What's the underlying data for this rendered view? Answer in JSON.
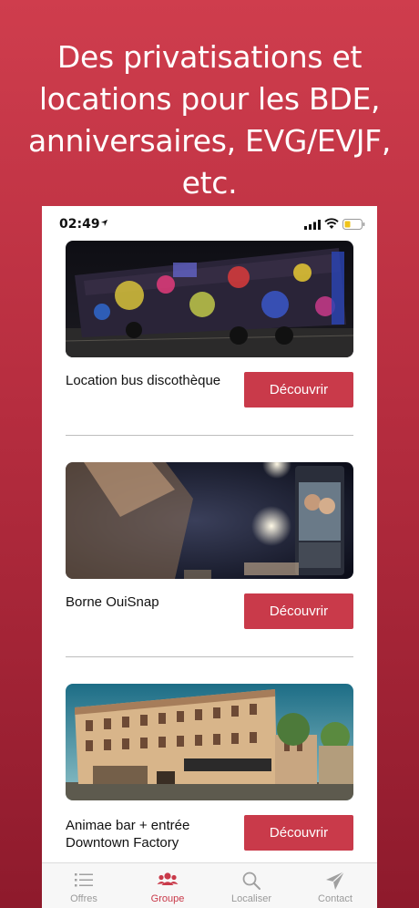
{
  "headline": "Des privatisations et locations pour les BDE, anniversaires, EVG/EVJF, etc.",
  "status": {
    "time": "02:49"
  },
  "colors": {
    "accent": "#c93a4a",
    "background": "#b62d3f"
  },
  "cards": [
    {
      "title": "Location bus discothèque",
      "button": "Découvrir",
      "image": "party-bus-photo"
    },
    {
      "title": "Borne OuiSnap",
      "button": "Découvrir",
      "image": "photobooth-photo"
    },
    {
      "title": "Animae bar + entrée Downtown Factory",
      "button": "Découvrir",
      "image": "building-photo"
    }
  ],
  "tabs": [
    {
      "label": "Offres",
      "icon": "list-icon",
      "active": false
    },
    {
      "label": "Groupe",
      "icon": "group-icon",
      "active": true
    },
    {
      "label": "Localiser",
      "icon": "search-icon",
      "active": false
    },
    {
      "label": "Contact",
      "icon": "send-icon",
      "active": false
    }
  ]
}
